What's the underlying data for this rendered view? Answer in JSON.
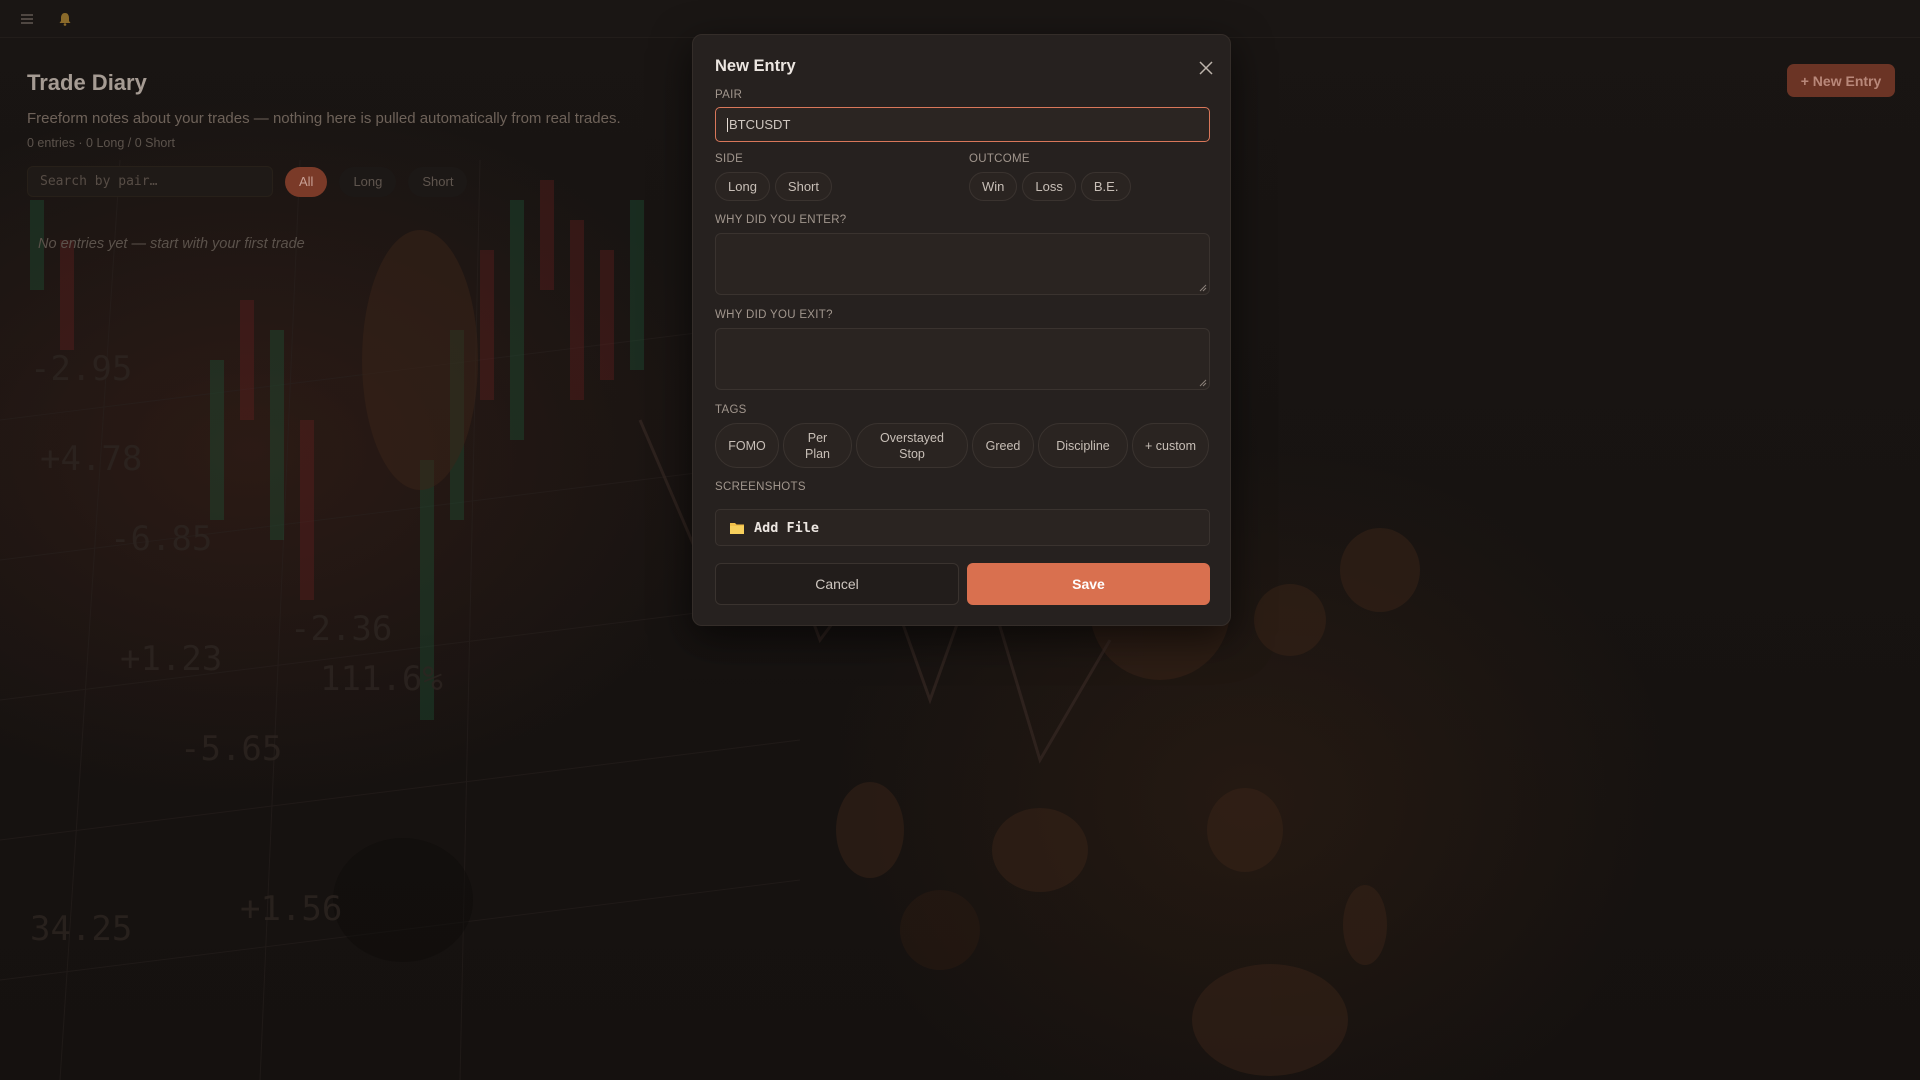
{
  "topbar": {
    "menu_icon": "hamburger-menu-icon",
    "notify_icon": "bell-icon"
  },
  "page": {
    "title": "Trade Diary",
    "subtitle": "Freeform notes about your trades — nothing here is pulled automatically from real trades.",
    "counts": "0 entries · 0 Long / 0 Short",
    "search_placeholder": "Search by pair…",
    "filters": [
      "All",
      "Long",
      "Short"
    ],
    "active_filter": "All",
    "empty_message": "No entries yet — start with your first trade",
    "new_entry_label": "+ New Entry"
  },
  "modal": {
    "title": "New Entry",
    "close_icon": "close-icon",
    "pair_label": "PAIR",
    "pair_placeholder": "BTCUSDT",
    "side_label": "SIDE",
    "side_options": [
      "Long",
      "Short"
    ],
    "outcome_label": "OUTCOME",
    "outcome_options": [
      "Win",
      "Loss",
      "B.E."
    ],
    "enter_label": "WHY DID YOU ENTER?",
    "exit_label": "WHY DID YOU EXIT?",
    "tags_label": "TAGS",
    "tags": [
      "FOMO",
      "Per Plan",
      "Overstayed Stop",
      "Greed",
      "Discipline",
      "+ custom"
    ],
    "screenshots_label": "SCREENSHOTS",
    "add_file_label": "Add File",
    "add_file_icon": "folder-icon",
    "cancel_label": "Cancel",
    "save_label": "Save"
  },
  "colors": {
    "accent": "#d9704f",
    "modal_bg": "#26211f",
    "page_bg": "#151210"
  }
}
